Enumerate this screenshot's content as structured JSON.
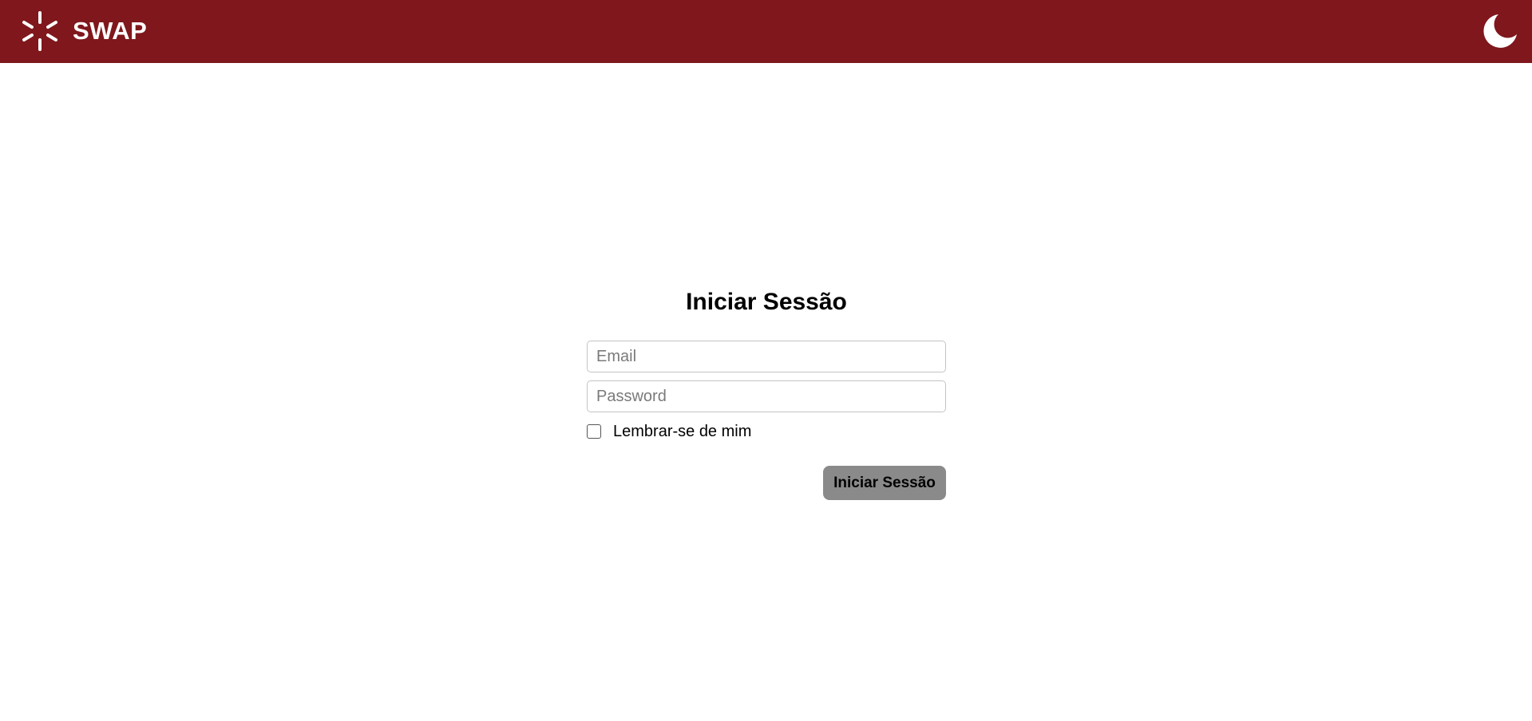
{
  "header": {
    "brand": "SWAP",
    "logo_icon": "asterisk-logo-icon",
    "theme_toggle_icon": "moon-icon",
    "background_color": "#7f171c"
  },
  "login": {
    "title": "Iniciar Sessão",
    "email": {
      "placeholder": "Email",
      "value": ""
    },
    "password": {
      "placeholder": "Password",
      "value": ""
    },
    "remember_me": {
      "label": "Lembrar-se de mim",
      "checked": false
    },
    "submit_label": "Iniciar Sessão",
    "submit_color": "#8a8a8a"
  }
}
